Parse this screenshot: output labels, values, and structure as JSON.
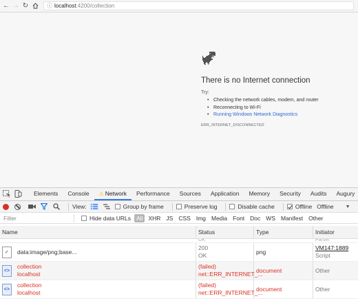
{
  "browser": {
    "url_host": "localhost",
    "url_path": ":4200/collection"
  },
  "offline_page": {
    "title": "There is no Internet connection",
    "try_label": "Try:",
    "suggestions": [
      "Checking the network cables, modem, and router",
      "Reconnecting to Wi-Fi",
      "Running Windows Network Diagnostics"
    ],
    "error_code": "ERR_INTERNET_DISCONNECTED"
  },
  "devtools": {
    "tabs": [
      "Elements",
      "Console",
      "Network",
      "Performance",
      "Sources",
      "Application",
      "Memory",
      "Security",
      "Audits",
      "Augury"
    ],
    "active_tab": "Network",
    "toolbar": {
      "view_label": "View:",
      "group_by_frame": "Group by frame",
      "preserve_log": "Preserve log",
      "disable_cache": "Disable cache",
      "offline_label": "Offline",
      "throttle_value": "Offline"
    },
    "filter": {
      "placeholder": "Filter",
      "hide_data_urls": "Hide data URLs",
      "types": [
        "All",
        "XHR",
        "JS",
        "CSS",
        "Img",
        "Media",
        "Font",
        "Doc",
        "WS",
        "Manifest",
        "Other"
      ]
    },
    "columns": {
      "name": "Name",
      "status": "Status",
      "type": "Type",
      "initiator": "Initiator"
    },
    "clipped_row": {
      "status": "OK",
      "initiator": "Parser"
    },
    "rows": [
      {
        "name": "data:image/png;base...",
        "name2": "",
        "status": "200",
        "status2": "OK",
        "type": "png",
        "initiator": "VM147:1889",
        "initiator2": "Script"
      },
      {
        "name": "collection",
        "name2": "localhost",
        "status": "(failed)",
        "status2": "net::ERR_INTERNET_...",
        "type": "document",
        "initiator": "Other",
        "initiator2": ""
      },
      {
        "name": "collection",
        "name2": "localhost",
        "status": "(failed)",
        "status2": "net::ERR_INTERNET_...",
        "type": "document",
        "initiator": "Other",
        "initiator2": ""
      }
    ]
  }
}
